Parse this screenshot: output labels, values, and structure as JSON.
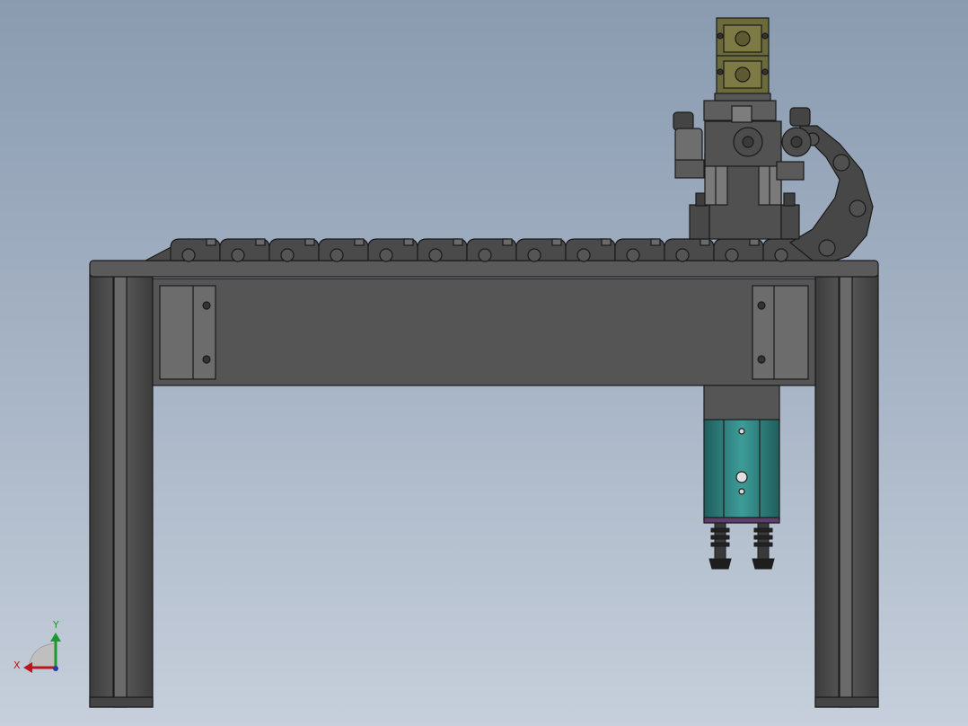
{
  "view": {
    "background_top": "#8a9bb0",
    "background_bottom": "#c6cfdb",
    "body_color": "#4f4f4f",
    "edge_color": "#1a1a1a",
    "cylinder_color": "#2e7d7a",
    "gripper_color": "#6a6a3a",
    "flange_color": "#5a3f6a"
  },
  "triad": {
    "x_label": "X",
    "y_label": "Y",
    "x_color": "#c0141c",
    "y_color": "#1a9a2a",
    "z_color": "#1f3fa6"
  },
  "parts": {
    "frame": "gantry-frame",
    "drag_chain": "cable-drag-chain",
    "carriage": "linear-carriage",
    "gripper_stack": "gripper-stack",
    "cylinder": "pneumatic-cylinder",
    "suction_cups": "vacuum-suction-cups"
  }
}
